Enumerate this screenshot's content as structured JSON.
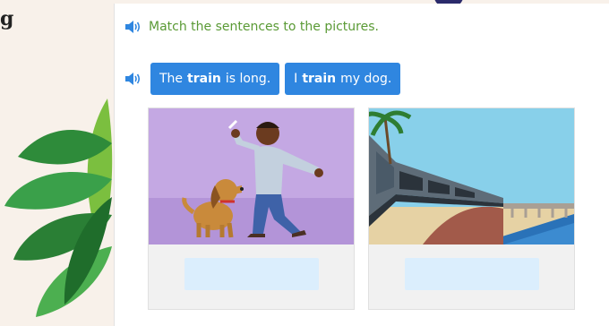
{
  "side_text": "g",
  "instruction": {
    "text": "Match the sentences to the pictures."
  },
  "choices": [
    {
      "pre": "The",
      "word": "train",
      "post": "is long."
    },
    {
      "pre": "I",
      "word": "train",
      "post": "my dog."
    }
  ],
  "icons": {
    "speaker": "speaker-icon",
    "plant": "plant-leaves-icon"
  },
  "colors": {
    "accent": "#2f86e0",
    "instruction_text": "#5a9a35",
    "dropzone": "#dbeefd"
  }
}
